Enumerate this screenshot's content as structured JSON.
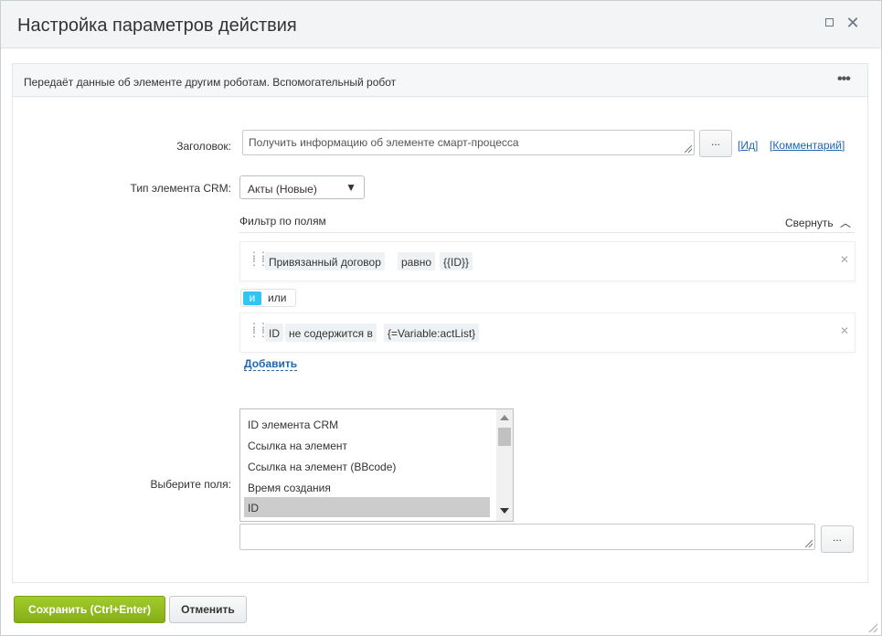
{
  "dialog": {
    "title": "Настройка параметров действия",
    "maximize_icon": "maximize-icon",
    "close_icon": "close-icon",
    "close_symbol": "✕"
  },
  "panel": {
    "description": "Передаёт данные об элементе другим роботам. Вспомогательный робот",
    "menu_symbol": "•••"
  },
  "form": {
    "title_label": "Заголовок:",
    "title_value": "Получить информацию об элементе смарт-процесса",
    "dots_label": "...",
    "id_link": "Ид",
    "comment_link": "Комментарий",
    "crm_type_label": "Тип элемента CRM:",
    "crm_type_value": "Акты (Новые)",
    "filter_title": "Фильтр по полям",
    "collapse_label": "Свернуть",
    "conditions": [
      {
        "field": "Привязанный договор",
        "operator": "равно",
        "value": "{{ID}}"
      },
      {
        "field": "ID",
        "operator": "не содержится в",
        "value": "{=Variable:actList}"
      }
    ],
    "logic_and": "и",
    "logic_or": "или",
    "add_label": "Добавить",
    "fields_label": "Выберите поля:",
    "fields_options": [
      "ID элемента CRM",
      "Ссылка на элемент",
      "Ссылка на элемент (BBcode)",
      "Время создания",
      "ID"
    ],
    "fields_selected": "ID",
    "extra_value": "",
    "extra_dots_label": "..."
  },
  "footer": {
    "save_label": "Сохранить (Ctrl+Enter)",
    "cancel_label": "Отменить"
  },
  "colors": {
    "save_green": "#8fb81c",
    "and_blue": "#2fc6f6",
    "link_blue": "#2067b0"
  }
}
